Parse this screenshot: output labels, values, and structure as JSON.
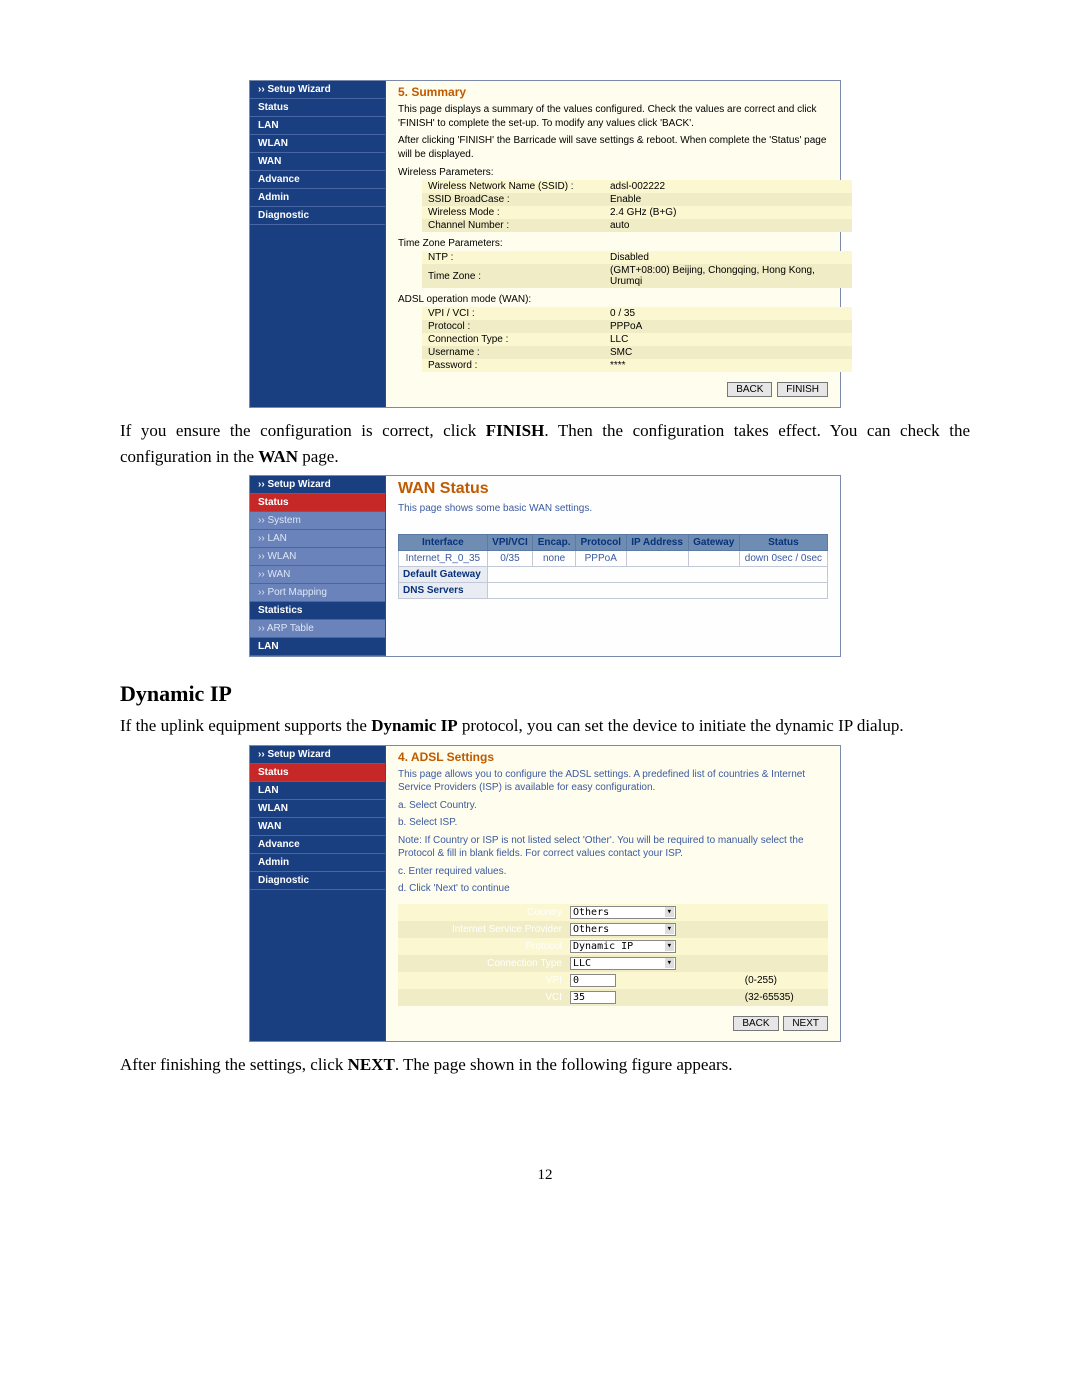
{
  "doc": {
    "para1_a": "If you ensure the configuration is correct, click ",
    "para1_b": "FINISH",
    "para1_c": ". Then the configuration takes effect. You can check the configuration in the ",
    "para1_d": "WAN",
    "para1_e": " page.",
    "heading_dynamic": "Dynamic IP",
    "para2_a": "If the uplink equipment supports the ",
    "para2_b": "Dynamic IP",
    "para2_c": " protocol, you can set the device to initiate the dynamic IP dialup.",
    "para3_a": "After finishing the settings, click ",
    "para3_b": "NEXT",
    "para3_c": ". The page shown in the following figure appears.",
    "page_number": "12"
  },
  "shot1": {
    "sidebar": [
      "›› Setup Wizard",
      "Status",
      "LAN",
      "WLAN",
      "WAN",
      "Advance",
      "Admin",
      "Diagnostic"
    ],
    "title": "5. Summary",
    "blurb1": "This page displays a summary of the values configured. Check the values are correct and click 'FINISH' to complete the set-up. To modify any values click 'BACK'.",
    "blurb2": "After clicking 'FINISH' the Barricade will save settings & reboot. When complete the 'Status' page will be displayed.",
    "sections": {
      "wireless": {
        "heading": "Wireless Parameters:",
        "rows": [
          {
            "k": "Wireless Network Name (SSID) :",
            "v": "adsl-002222"
          },
          {
            "k": "SSID BroadCase :",
            "v": "Enable"
          },
          {
            "k": "Wireless Mode :",
            "v": "2.4 GHz (B+G)"
          },
          {
            "k": "Channel Number :",
            "v": "auto"
          }
        ]
      },
      "timezone": {
        "heading": "Time Zone Parameters:",
        "rows": [
          {
            "k": "NTP :",
            "v": "Disabled"
          },
          {
            "k": "Time Zone :",
            "v": "(GMT+08:00) Beijing, Chongqing, Hong Kong, Urumqi"
          }
        ]
      },
      "adsl": {
        "heading": "ADSL operation mode (WAN):",
        "rows": [
          {
            "k": "VPI / VCI :",
            "v": "0 / 35"
          },
          {
            "k": "Protocol :",
            "v": "PPPoA"
          },
          {
            "k": "Connection Type :",
            "v": "LLC"
          },
          {
            "k": "Username :",
            "v": "SMC"
          },
          {
            "k": "Password :",
            "v": "****"
          }
        ]
      }
    },
    "buttons": {
      "back": "BACK",
      "finish": "FINISH"
    }
  },
  "shot2": {
    "sidebar": [
      "›› Setup Wizard",
      "Status",
      "›› System",
      "›› LAN",
      "›› WLAN",
      "›› WAN",
      "›› Port Mapping",
      "Statistics",
      "›› ARP Table",
      "LAN"
    ],
    "title": "WAN Status",
    "blurb": "This page shows some basic WAN settings.",
    "headers": [
      "Interface",
      "VPI/VCI",
      "Encap.",
      "Protocol",
      "IP Address",
      "Gateway",
      "Status"
    ],
    "row": {
      "iface": "Internet_R_0_35",
      "vpivci": "0/35",
      "encap": "none",
      "proto": "PPPoA",
      "ip": "",
      "gw": "",
      "status": "down 0sec / 0sec"
    },
    "dg": "Default Gateway",
    "dns": "DNS Servers"
  },
  "shot3": {
    "sidebar": [
      "›› Setup Wizard",
      "Status",
      "LAN",
      "WLAN",
      "WAN",
      "Advance",
      "Admin",
      "Diagnostic"
    ],
    "title": "4. ADSL Settings",
    "blurb1": "This page allows you to configure the ADSL settings. A predefined list of countries & Internet Service Providers (ISP) is available for easy configuration.",
    "steps": {
      "a": "a. Select Country.",
      "b": "b. Select ISP.",
      "note": "Note: If Country or ISP is not listed select 'Other'. You will be required to manually select the Protocol & fill in blank fields. For correct values contact your ISP.",
      "c": "c. Enter required values.",
      "d": "d. Click 'Next' to continue"
    },
    "form": {
      "rows": [
        {
          "lbl": "Country",
          "type": "select",
          "val": "Others"
        },
        {
          "lbl": "Internet Service Provider",
          "type": "select",
          "val": "Others"
        },
        {
          "lbl": "Protocol",
          "type": "select",
          "val": "Dynamic IP"
        },
        {
          "lbl": "Connection Type",
          "type": "select",
          "val": "LLC"
        },
        {
          "lbl": "VPI",
          "type": "input",
          "val": "0",
          "hint": "(0-255)"
        },
        {
          "lbl": "VCI",
          "type": "input",
          "val": "35",
          "hint": "(32-65535)"
        }
      ]
    },
    "buttons": {
      "back": "BACK",
      "next": "NEXT"
    }
  }
}
